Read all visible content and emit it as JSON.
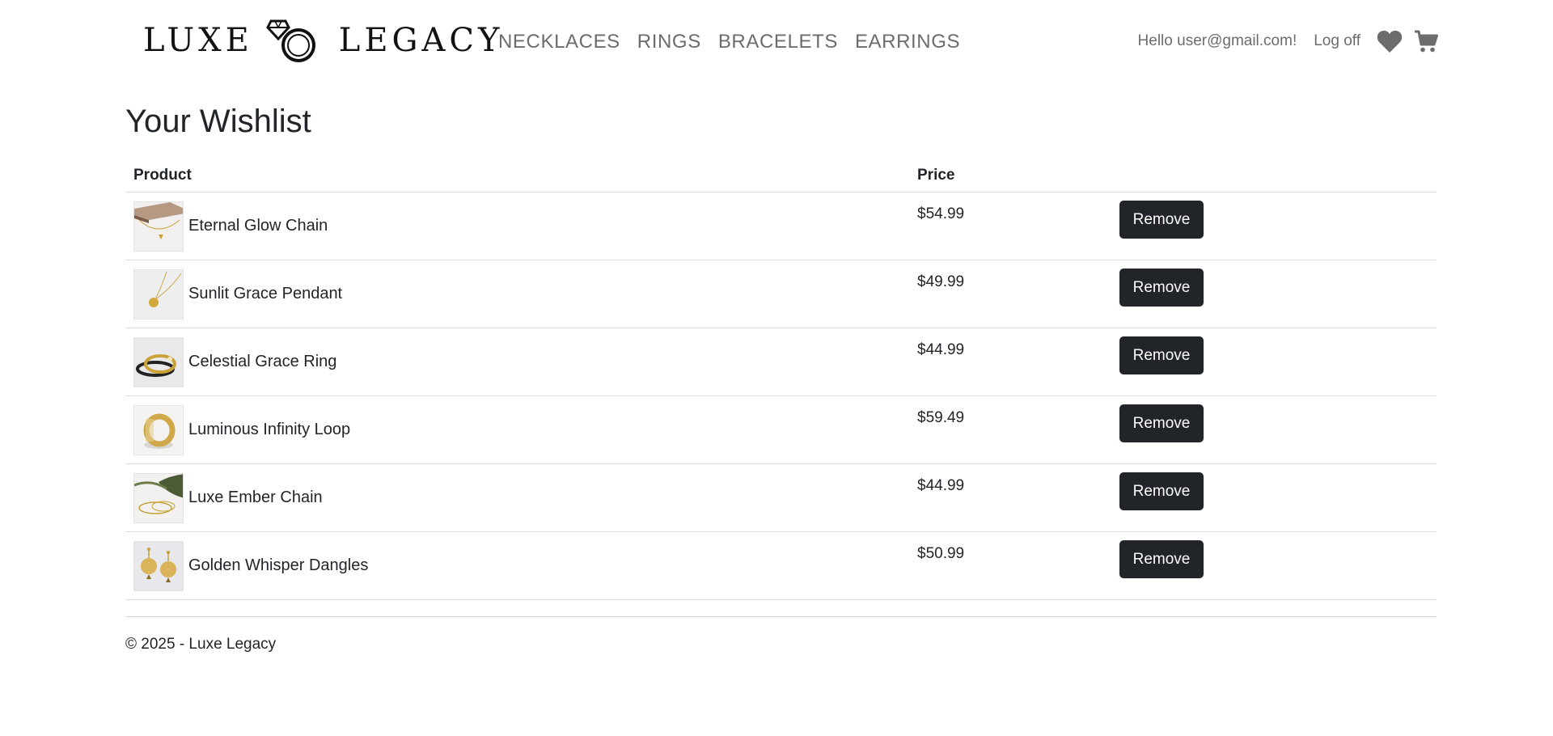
{
  "brand": {
    "name_left": "LUXE",
    "name_right": "LEGACY"
  },
  "nav": [
    {
      "label": "NECKLACES"
    },
    {
      "label": "RINGS"
    },
    {
      "label": "BRACELETS"
    },
    {
      "label": "EARRINGS"
    }
  ],
  "user": {
    "greeting": "Hello user@gmail.com!",
    "logoff_label": "Log off",
    "wishlist_icon": "heart-icon",
    "cart_icon": "cart-icon"
  },
  "page": {
    "title": "Your Wishlist"
  },
  "table": {
    "headers": {
      "product": "Product",
      "price": "Price"
    },
    "rows": [
      {
        "name": "Eternal Glow Chain",
        "price": "$54.99",
        "action": "Remove",
        "thumb": "necklace"
      },
      {
        "name": "Sunlit Grace Pendant",
        "price": "$49.99",
        "action": "Remove",
        "thumb": "pendant"
      },
      {
        "name": "Celestial Grace Ring",
        "price": "$44.99",
        "action": "Remove",
        "thumb": "ring-stack"
      },
      {
        "name": "Luminous Infinity Loop",
        "price": "$59.49",
        "action": "Remove",
        "thumb": "band-ring"
      },
      {
        "name": "Luxe Ember Chain",
        "price": "$44.99",
        "action": "Remove",
        "thumb": "bracelet"
      },
      {
        "name": "Golden Whisper Dangles",
        "price": "$50.99",
        "action": "Remove",
        "thumb": "earrings"
      }
    ]
  },
  "footer": {
    "text": "© 2025 - Luxe Legacy"
  },
  "colors": {
    "button_bg": "#212529",
    "nav_text": "#6c6c6c",
    "gold": "#c9a23a"
  }
}
